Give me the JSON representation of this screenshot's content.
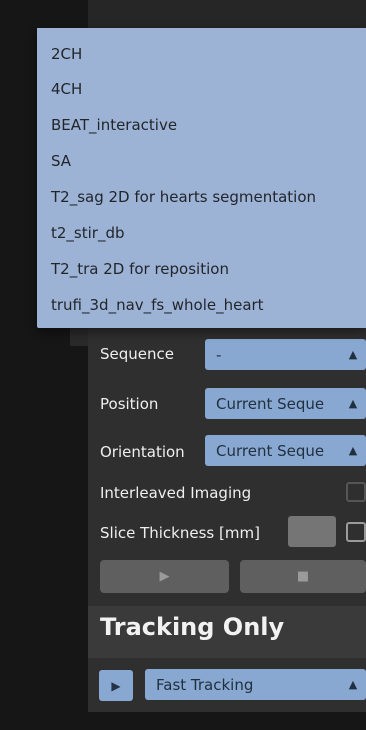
{
  "menu": {
    "items": [
      "2CH",
      "4CH",
      "BEAT_interactive",
      "SA",
      "T2_sag 2D for hearts segmentation",
      "t2_stir_db",
      "T2_tra 2D for reposition",
      "trufi_3d_nav_fs_whole_heart"
    ]
  },
  "form": {
    "sequence_label": "Sequence",
    "sequence_value": "-",
    "position_label": "Position",
    "position_value": "Current Seque",
    "orientation_label": "Orientation",
    "orientation_value": "Current Seque",
    "interleaved_label": "Interleaved Imaging",
    "slice_thickness_label": "Slice Thickness [mm]"
  },
  "tracking": {
    "title": "Tracking Only",
    "mode_value": "Fast Tracking"
  },
  "icons": {
    "dropdown_arrow": "triangle-up-icon",
    "play": "play-icon",
    "stop": "stop-icon"
  },
  "colors": {
    "accent": "#89a8d1",
    "menu_bg": "#9db3d5",
    "panel_bg": "#2f2f2f",
    "background": "#161616"
  }
}
